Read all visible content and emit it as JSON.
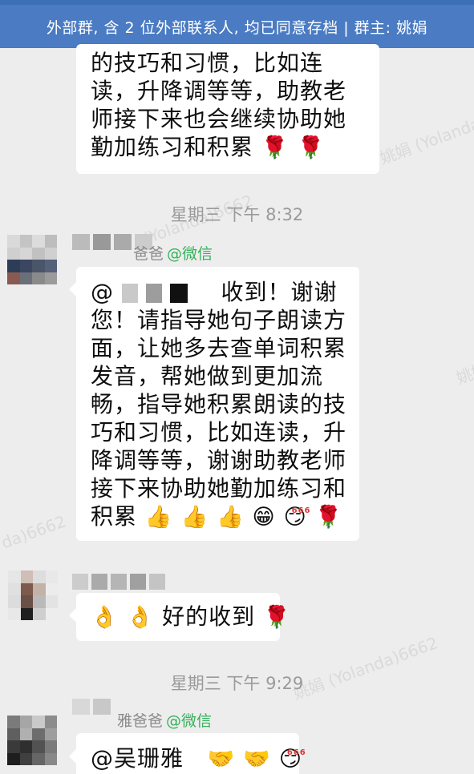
{
  "banner": {
    "text": "外部群, 含 2 位外部联系人, 均已同意存档 | 群主: 姚娟"
  },
  "watermarks": [
    "姚娟 (Yolanda",
    "(Yolanda)6662",
    "da)6662",
    "姚娟 (Yolanda)6662",
    "姚娟"
  ],
  "messages": [
    {
      "lines": [
        "的技巧和习惯，比如连",
        "读，升降调等等，助教老",
        "师接下来也会继续协助她",
        "勤加练习和积累"
      ],
      "emojis": [
        "🌹",
        "🌹"
      ]
    },
    {
      "time": "星期三  下午 8:32"
    },
    {
      "sender_suffix": "爸爸",
      "sender_tag": "@微信",
      "lines": [
        "收到！谢谢",
        "您！请指导她句子朗读方",
        "面，让她多去查单词积累",
        "发音，帮她做到更加流",
        "畅，指导她积累朗读的技",
        "巧和习惯，比如连读，升",
        "降调等等，谢谢助教老师",
        "接下来协助她勤加练习和",
        "积累"
      ],
      "mention_prefix": "@",
      "emojis": [
        "👍",
        "👍",
        "👍",
        "😁",
        "😏",
        "🌹"
      ],
      "emoji_badge": "666"
    },
    {
      "lines": [
        "好的收到"
      ],
      "emojis_before": [
        "👌",
        "👌"
      ],
      "emojis_after": [
        "🌹"
      ]
    },
    {
      "time": "星期三  下午 9:29"
    },
    {
      "sender_suffix": "雅爸爸",
      "sender_tag": "@微信",
      "lines": [
        "@吴珊雅"
      ],
      "emojis": [
        "🤝",
        "🤝",
        "😏"
      ],
      "emoji_badge": "666"
    }
  ]
}
